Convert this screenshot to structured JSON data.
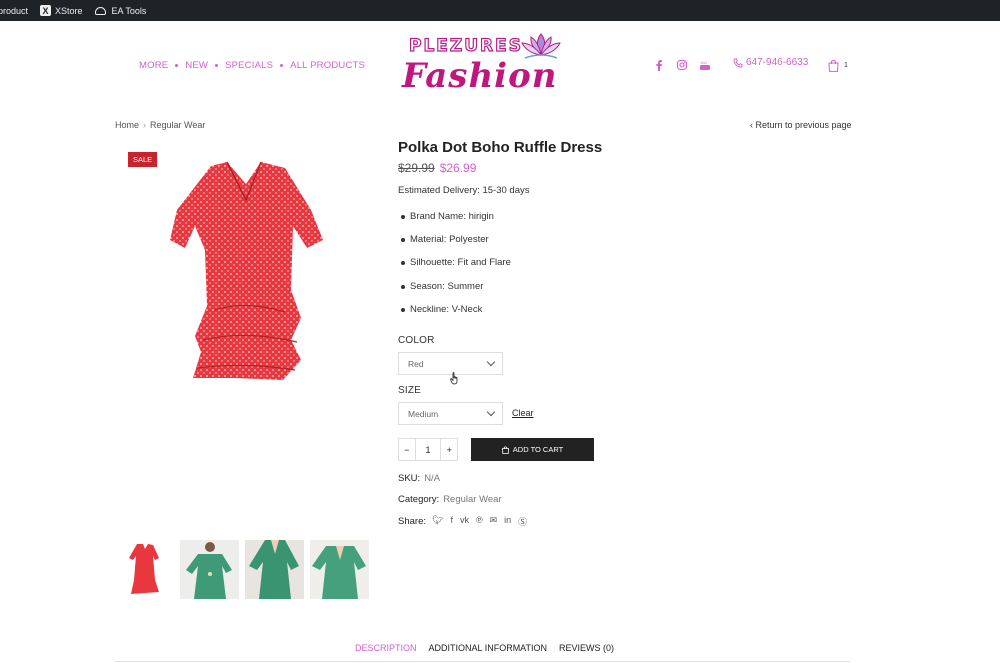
{
  "adminbar": {
    "items": [
      {
        "label": "product",
        "icon": "none"
      },
      {
        "label": "XStore",
        "icon": "x-icon"
      },
      {
        "label": "EA Tools",
        "icon": "ea-icon"
      }
    ]
  },
  "header": {
    "nav": [
      "MORE",
      "NEW",
      "SPECIALS",
      "ALL PRODUCTS"
    ],
    "logo_top": "PLEZURES",
    "logo_bottom": "Fashion",
    "social": [
      "facebook-icon",
      "instagram-icon",
      "youtube-icon"
    ],
    "phone": "647-946-6633",
    "cart_count": "1",
    "brand_color": "#d45fd0"
  },
  "breadcrumb": {
    "home": "Home",
    "current": "Regular Wear"
  },
  "return_link": "Return to previous page",
  "product": {
    "badge": "SALE",
    "title": "Polka Dot Boho Ruffle Dress",
    "old_price": "$29.99",
    "price": "$26.99",
    "delivery": "Estimated Delivery: 15-30 days",
    "specs": [
      "Brand Name: hirigin",
      "Material: Polyester",
      "Silhouette: Fit and Flare",
      "Season: Summer",
      "Neckline: V-Neck"
    ],
    "color_label": "COLOR",
    "color_value": "Red",
    "size_label": "SIZE",
    "size_value": "Medium",
    "clear": "Clear",
    "qty": "1",
    "add_to_cart": "ADD TO CART",
    "sku_label": "SKU:",
    "sku_value": "N/A",
    "category_label": "Category:",
    "category_value": "Regular Wear",
    "share_label": "Share:"
  },
  "tabs": [
    "DESCRIPTION",
    "ADDITIONAL INFORMATION",
    "REVIEWS (0)"
  ]
}
